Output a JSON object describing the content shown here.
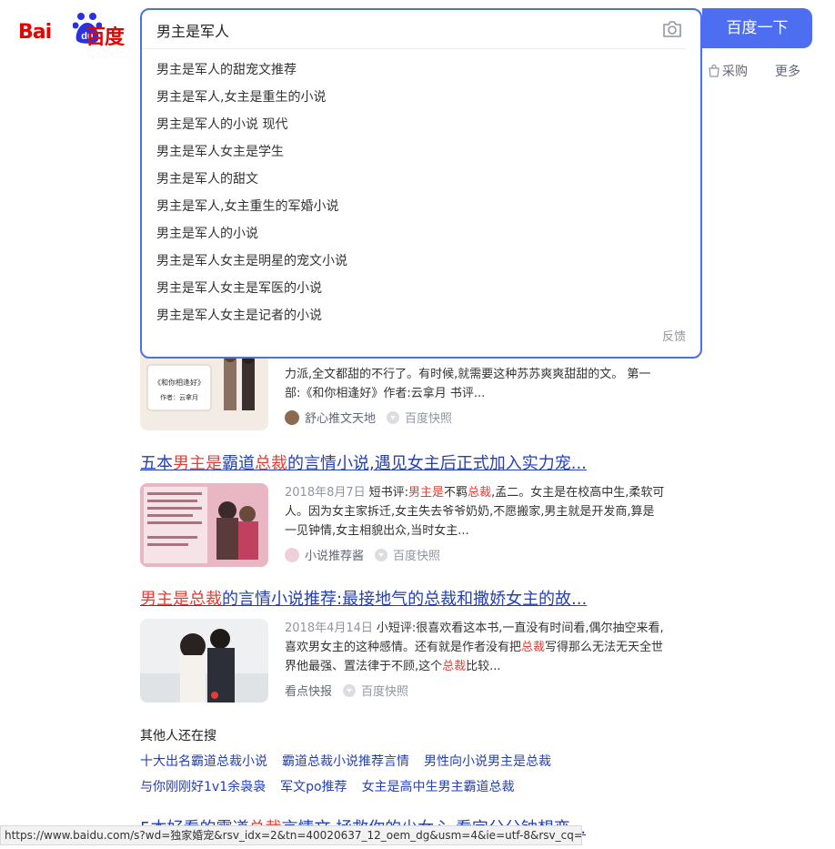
{
  "logo": {
    "left_text": "Bai",
    "paw_text": "du",
    "right_text": "百度"
  },
  "search": {
    "query": "男主是军人",
    "button_label": "百度一下",
    "suggestions": [
      "男主是军人的甜宠文推荐",
      "男主是军人,女主是重生的小说",
      "男主是军人的小说 现代",
      "男主是军人女主是学生",
      "男主是军人的甜文",
      "男主是军人,女主重生的军婚小说",
      "男主是军人的小说",
      "男主是军人女主是明星的宠文小说",
      "男主是军人女主是军医的小说",
      "男主是军人女主是记者的小说"
    ],
    "feedback": "反馈"
  },
  "tabs": {
    "purchase": "采购",
    "more": "更多"
  },
  "results": [
    {
      "snippet_l1": "力派,全文都甜的不行了。有时候,就需要这种苏苏爽爽甜甜的文。 第一",
      "snippet_l2": "部:《和你相逢好》作者:云拿月 书评...",
      "source": "舒心推文天地",
      "snapshot": "百度快照",
      "thumb_title": "《和你相逢好》",
      "thumb_author": "作者：云拿月"
    },
    {
      "title_a": "五本",
      "title_hl1": "男主是",
      "title_b": "霸道",
      "title_hl2": "总裁",
      "title_c": "的言情小说,遇见女主后正式加入实力宠...",
      "date": "2018年8月7日",
      "snippet_a": "短书评:",
      "snippet_hl1": "男主是",
      "snippet_b": "不羁",
      "snippet_hl2": "总裁",
      "snippet_c": ",孟二。女主是在校高中生,柔软可",
      "snippet_l2": "人。因为女主家拆迁,女主失去爷爷奶奶,不愿搬家,男主就是开发商,算是",
      "snippet_l3": "一见钟情,女主相貌出众,当时女主...",
      "source": "小说推荐酱",
      "snapshot": "百度快照"
    },
    {
      "title_hl1": "男主是",
      "title_hl2": "总裁",
      "title_c": "的言情小说推荐:最接地气的总裁和撒娇女主的故...",
      "date": "2018年4月14日",
      "snippet_a": "小短评:很喜欢看这本书,一直没有时间看,偶尔抽空来看,",
      "snippet_l2_a": "喜欢男女主的这种感情。还有就是作者没有把",
      "snippet_l2_hl": "总裁",
      "snippet_l2_b": "写得那么无法无天全世",
      "snippet_l3_a": "界他最强、置法律于不顾,这个",
      "snippet_l3_hl": "总裁",
      "snippet_l3_b": "比较...",
      "source": "看点快报",
      "snapshot": "百度快照"
    }
  ],
  "related": {
    "title": "其他人还在搜",
    "row1": [
      "十大出名霸道总裁小说",
      "霸道总裁小说推荐言情",
      "男性向小说男主是总裁"
    ],
    "row2": [
      "与你刚刚好1v1余袅袅",
      "军文po推荐",
      "女主是高中生男主霸道总裁"
    ]
  },
  "partial_title": {
    "a": "5本好看的霸道",
    "hl": "总裁",
    "b": "言情文,拯救你的少女心,看完分分钟想恋..."
  },
  "status_url": "https://www.baidu.com/s?wd=独家婚宠&rsv_idx=2&tn=40020637_12_oem_dg&usm=4&ie=utf-8&rsv_cq=...",
  "colors": {
    "accent": "#4e6ef2",
    "link": "#2440b3",
    "highlight": "#e33e33",
    "brand_red": "#e10602"
  }
}
